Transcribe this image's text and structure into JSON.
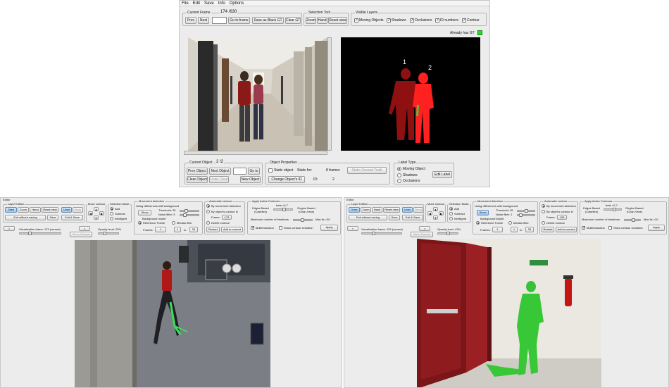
{
  "top": {
    "menu": [
      "File",
      "Edit",
      "Save",
      "Info",
      "Options"
    ],
    "current_frame": {
      "legend": "Current Frame",
      "counter": "174 /630",
      "prev": "Prev",
      "next": "Next",
      "goto": "Go to frame",
      "save_black": "Save as Black GT",
      "clear_gt": "Clear GT"
    },
    "selection_tool": {
      "legend": "Selection Tool",
      "zoom": "Zoom",
      "hand": "Hand",
      "reset": "Reset view"
    },
    "visible_layers": {
      "legend": "Visible Layers",
      "items": [
        "Moving Objects",
        "Shadows",
        "Occlusions",
        "ID numbers",
        "Contour"
      ]
    },
    "already_gt": "Already has GT",
    "already_gt_color": "#22dd22",
    "mask_ids": [
      "1",
      "2"
    ],
    "current_object": {
      "legend": "Current Object",
      "counter": "2 /2",
      "prev": "Prev Object",
      "next": "Next Object",
      "goto": "Go to",
      "clear": "Clear Object",
      "undo": "Undo Clear",
      "new": "New Object"
    },
    "object_properties": {
      "legend": "Object Properties",
      "static_object": "Static object",
      "static_for": "Static for:",
      "frames": "8 frames",
      "static_gt": "Static Ground Truth",
      "change_id": "Change Object's ID",
      "id_label": "ID:",
      "id_value": "2"
    },
    "label_type": {
      "legend": "Label Type",
      "items": [
        "Moving Object",
        "Shadows",
        "Occlusions"
      ],
      "button": "Edit Label"
    }
  },
  "editor_left": {
    "title": "Editor",
    "layer_edition": {
      "legend": "Layer Edition",
      "draw": "Draw",
      "zoom": "Zoom",
      "hand": "Hand",
      "reset": "Reset view",
      "undo": "Undo",
      "redo": "Redo",
      "exit": "Exit without saving",
      "save": "Save",
      "exit_save": "Exit & Save"
    },
    "move_contour": {
      "legend": "Move contour"
    },
    "selection_mode": {
      "legend": "Selection Mode",
      "items": [
        "Add",
        "Subtract",
        "Intelligent"
      ]
    },
    "movement_detection": {
      "legend": "Movement detection",
      "using": "Using differences with background",
      "show": "Show",
      "threshold": "Threshold: 30",
      "noise": "Noise filter: 3",
      "background_model": "Background model",
      "ref_frame": "Reference Frame",
      "median": "Median filter",
      "frames": "Frames:",
      "from": "1",
      "to_label": "to",
      "to": "30"
    },
    "automatic_contour": {
      "legend": "Automatic contour",
      "by_movement": "By movement detection",
      "by_contour": "By object's contour in",
      "frame_label": "Frame:",
      "frame_value": "173",
      "delete": "Delete contour",
      "restart": "Restart",
      "add": "Add to current"
    },
    "active_contours": {
      "legend": "Apply Active Contours",
      "edges": "Edges Based (Caselles)",
      "beta": "beta =0.7",
      "region": "Region Based (Chan-Vese)",
      "max_iter": "Maximum number of iterations:",
      "max_value": "Max its =30",
      "multiresolution": "Multiresolution",
      "show_evolution": "Show contour evolution",
      "apply": "Apply"
    },
    "visualization": "Visualization frame: 173 (current)",
    "go_current": "Go to Current",
    "opacity": "Opacity level: 29%"
  },
  "editor_right": {
    "title": "Editor",
    "layer_edition": {
      "legend": "Layer Edition",
      "draw": "Draw",
      "zoom": "Zoom",
      "hand": "Hand",
      "reset": "Reset view",
      "undo": "Undo",
      "redo": "Redo",
      "exit": "Exit without saving",
      "save": "Save",
      "exit_save": "Exit & Save"
    },
    "move_contour": {
      "legend": "Move contour"
    },
    "selection_mode": {
      "legend": "Selection Mode",
      "items": [
        "Add",
        "Subtract",
        "Intelligent"
      ]
    },
    "movement_detection": {
      "legend": "Movement detection",
      "using": "Using differences with background",
      "show": "Show",
      "threshold": "Threshold: 45",
      "noise": "Noise filter: 1",
      "background_model": "Background Model",
      "ref_frame": "Reference Frame",
      "median": "Median filter",
      "frames": "Frames:",
      "from": "1",
      "to_label": "to",
      "to": "30"
    },
    "automatic_contour": {
      "legend": "Automatic contour",
      "by_movement": "By movement detection",
      "by_contour": "By object's contour in",
      "frame_label": "Frame:",
      "frame_value": "133",
      "delete": "Delete contour",
      "restart": "Restart",
      "add": "Add to current"
    },
    "active_contours": {
      "legend": "Apply Active Contours",
      "edges": "Edges Based (Caselles)",
      "beta": "beta =0.7",
      "region": "Region Based (Chan-Vese)",
      "max_iter": "Maximum number of iterations:",
      "max_value": "Max its =30",
      "multiresolution": "Multiresolution",
      "show_evolution": "Show contour evolution",
      "apply": "Apply"
    },
    "visualization": "Visualization frame: 133 (current)",
    "go_current": "Go to Current",
    "opacity": "Opacity level: 43%"
  }
}
